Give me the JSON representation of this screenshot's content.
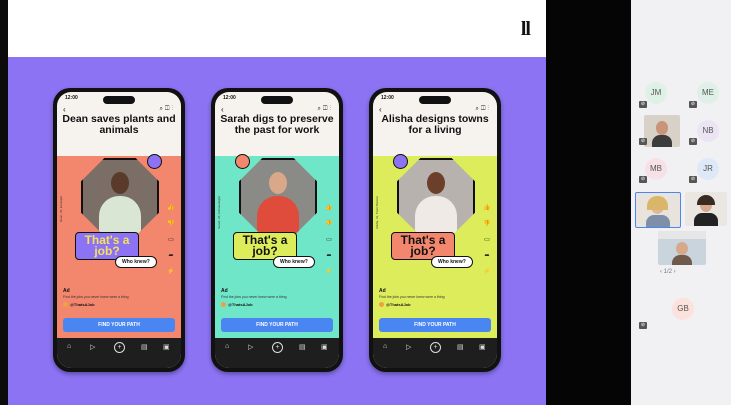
{
  "slide": {
    "logo": "ll",
    "cta_label": "FIND YOUR PATH",
    "phones": [
      {
        "headline": "Dean saves plants and animals",
        "badge": "That's a job?",
        "bubble": "Who knew?",
        "ad_tag": "Ad",
        "ad_text": "Find the jobs you never knew were a thing",
        "handle": "@ThatsAJob",
        "vertical_text": "Dean, 34, Ecologist",
        "bg_color": "#f3876e"
      },
      {
        "headline": "Sarah digs to preserve the past for work",
        "badge": "That's a job?",
        "bubble": "Who knew?",
        "ad_tag": "Ad",
        "ad_text": "Find the jobs you never knew were a thing",
        "handle": "@ThatsAJob",
        "vertical_text": "Sarah, 26, Archaeologist",
        "bg_color": "#6fe6c7"
      },
      {
        "headline": "Alisha designs towns for a living",
        "badge": "That's a job?",
        "bubble": "Who knew?",
        "ad_tag": "Ad",
        "ad_text": "Find the jobs you never knew were a thing",
        "handle": "@ThatsAJob",
        "vertical_text": "Alisha, 31, Town Planner",
        "bg_color": "#dcec5a"
      }
    ]
  },
  "participants": {
    "initials": [
      "JM",
      "ME",
      "NB",
      "MB",
      "JR",
      "GB"
    ],
    "pager": "1/2"
  },
  "colors": {
    "slide_background": "#8b73f3",
    "cta": "#4a86f2",
    "badge": "#8b73f3",
    "badge_text": "#f7e05a"
  }
}
